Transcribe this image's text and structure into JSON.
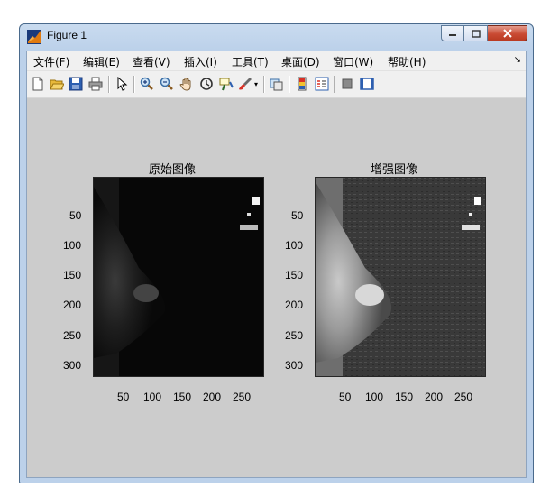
{
  "window": {
    "title": "Figure 1"
  },
  "menu": [
    "文件(F)",
    "编辑(E)",
    "查看(V)",
    "插入(I)",
    "工具(T)",
    "桌面(D)",
    "窗口(W)",
    "帮助(H)"
  ],
  "toolbar_icons": [
    "new-figure-icon",
    "open-file-icon",
    "save-icon",
    "print-icon",
    "pointer-icon",
    "zoom-in-icon",
    "zoom-out-icon",
    "pan-icon",
    "rotate-3d-icon",
    "data-cursor-icon",
    "brush-icon",
    "link-plot-icon",
    "colorbar-icon",
    "legend-icon",
    "hide-plot-tools-icon",
    "show-plot-tools-icon"
  ],
  "axes": [
    {
      "title": "原始图像",
      "xticks": [
        "50",
        "100",
        "150",
        "200",
        "250"
      ],
      "yticks": [
        "50",
        "100",
        "150",
        "200",
        "250",
        "300"
      ]
    },
    {
      "title": "增强图像",
      "xticks": [
        "50",
        "100",
        "150",
        "200",
        "250"
      ],
      "yticks": [
        "50",
        "100",
        "150",
        "200",
        "250",
        "300"
      ]
    }
  ]
}
